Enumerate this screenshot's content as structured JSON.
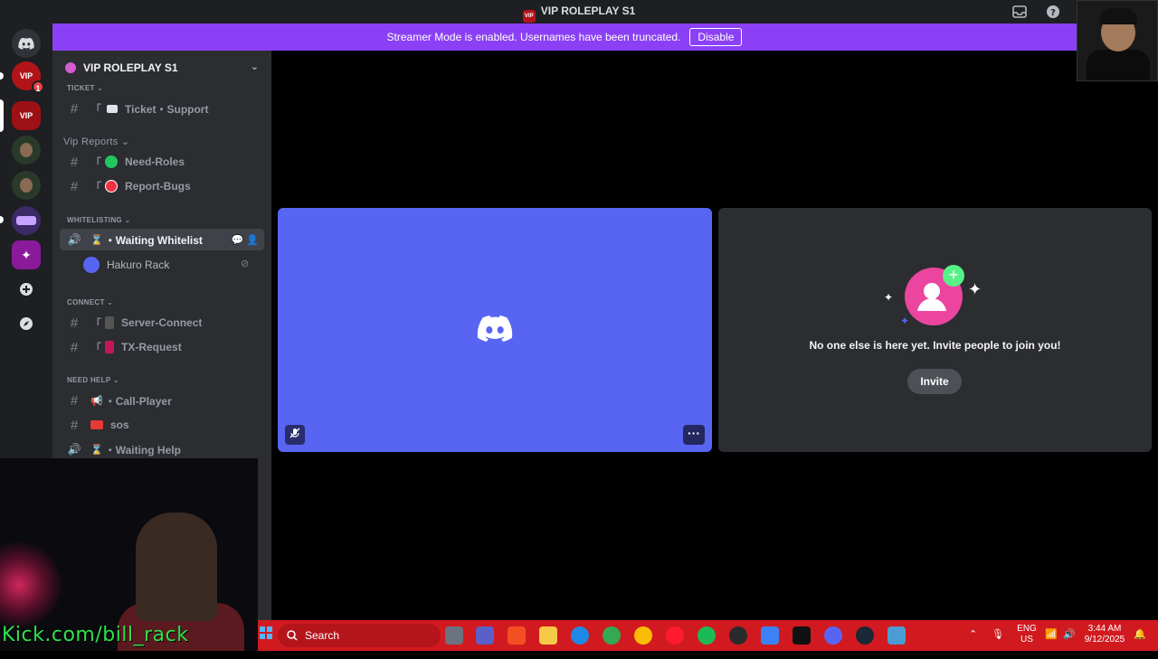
{
  "window": {
    "title": "VIP ROLEPLAY S1",
    "inbox_icon": "inbox-icon",
    "help_icon": "help-icon",
    "title_logo_text": "VIP"
  },
  "rail": {
    "home_icon": "discord-home-icon",
    "servers": [
      {
        "name": "vip-server-1",
        "label": "VIP",
        "badge": "1",
        "color": "#b3141a"
      },
      {
        "name": "vip-server-2",
        "label": "VIP",
        "color": "#9d1015"
      },
      {
        "name": "avatar-server-3",
        "label": "",
        "color": "#2a3a2a"
      },
      {
        "name": "avatar-server-4",
        "label": "",
        "color": "#2a3a2a"
      },
      {
        "name": "logo-server-5",
        "label": "",
        "color": "#3b2a66"
      },
      {
        "name": "logo-server-6",
        "label": "",
        "color": "#8a1a9a"
      }
    ],
    "add_server_icon": "add-server-icon",
    "explore_icon": "compass-icon"
  },
  "banner": {
    "text": "Streamer Mode is enabled. Usernames have been truncated.",
    "button": "Disable",
    "color": "#8b40f5"
  },
  "sidebar": {
    "server_name": "VIP ROLEPLAY S1",
    "categories": {
      "ticket": "TICKET",
      "vip_reports": "Vip Reports",
      "whitelisting": "WHITELISTING",
      "connect": "CONNECT",
      "need_help": "NEED HELP"
    },
    "channels": [
      {
        "id": "ticket-support",
        "prefix": "「",
        "emoji": "ticket",
        "label": "Ticket・Support"
      },
      {
        "id": "need-roles",
        "prefix": "「",
        "emoji": "green-circle",
        "label": "Need-Roles"
      },
      {
        "id": "report-bugs",
        "prefix": "「",
        "emoji": "red-circle",
        "label": "Report-Bugs"
      },
      {
        "id": "waiting-whitelist",
        "label": "・Waiting Whitelist"
      },
      {
        "id": "server-connect",
        "prefix": "「",
        "label": "Server-Connect"
      },
      {
        "id": "tx-request",
        "prefix": "「",
        "label": "TX-Request"
      },
      {
        "id": "call-player",
        "label": "・Call-Player"
      },
      {
        "id": "sos",
        "label": "sos"
      },
      {
        "id": "waiting-help",
        "label": "・Waiting Help"
      }
    ],
    "voice_user": "Hakuro Rack"
  },
  "stage": {
    "invite_text": "No one else is here yet. Invite people to join you!",
    "invite_button": "Invite",
    "main_tile_color": "#5865f2"
  },
  "overlay": {
    "watermark": "Kick.com/bill_rack"
  },
  "taskbar": {
    "search_label": "Search",
    "lang_line1": "ENG",
    "lang_line2": "US",
    "time": "3:44 AM",
    "date": "9/12/2025",
    "accent": "#d11a1f"
  }
}
